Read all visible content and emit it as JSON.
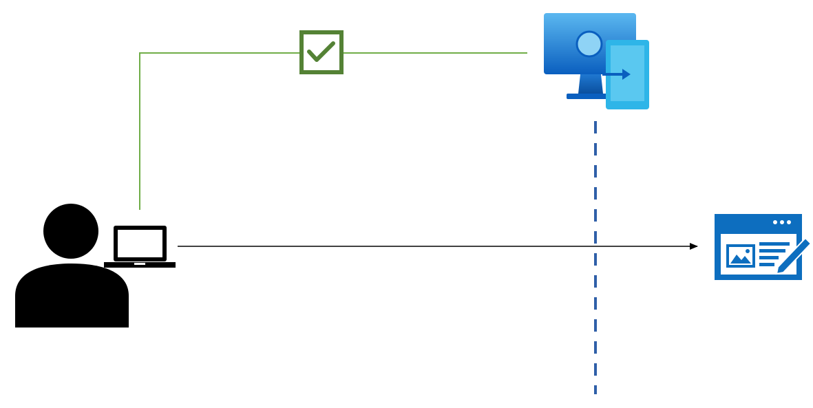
{
  "diagram": {
    "nodes": [
      {
        "id": "user",
        "icon": "user-icon"
      },
      {
        "id": "laptop",
        "icon": "laptop-icon"
      },
      {
        "id": "virtual-desktop",
        "icon": "virtual-desktop-icon"
      },
      {
        "id": "web-form",
        "icon": "web-form-icon"
      }
    ],
    "edges": [
      {
        "from": "laptop",
        "to": "virtual-desktop",
        "style": "solid",
        "status_icon": "checkmark-icon"
      },
      {
        "from": "laptop",
        "to": "web-form",
        "style": "solid",
        "arrow": true
      }
    ],
    "boundary": {
      "style": "dashed",
      "orientation": "vertical"
    }
  },
  "colors": {
    "user": "#000000",
    "approved_connection": "#70ad47",
    "check_badge": "#548235",
    "boundary": "#2f5fa8",
    "arrow": "#000000",
    "desktop_top": "#4fb0ec",
    "desktop_bottom": "#0a5fbf",
    "form_blue": "#0d6ebf"
  }
}
